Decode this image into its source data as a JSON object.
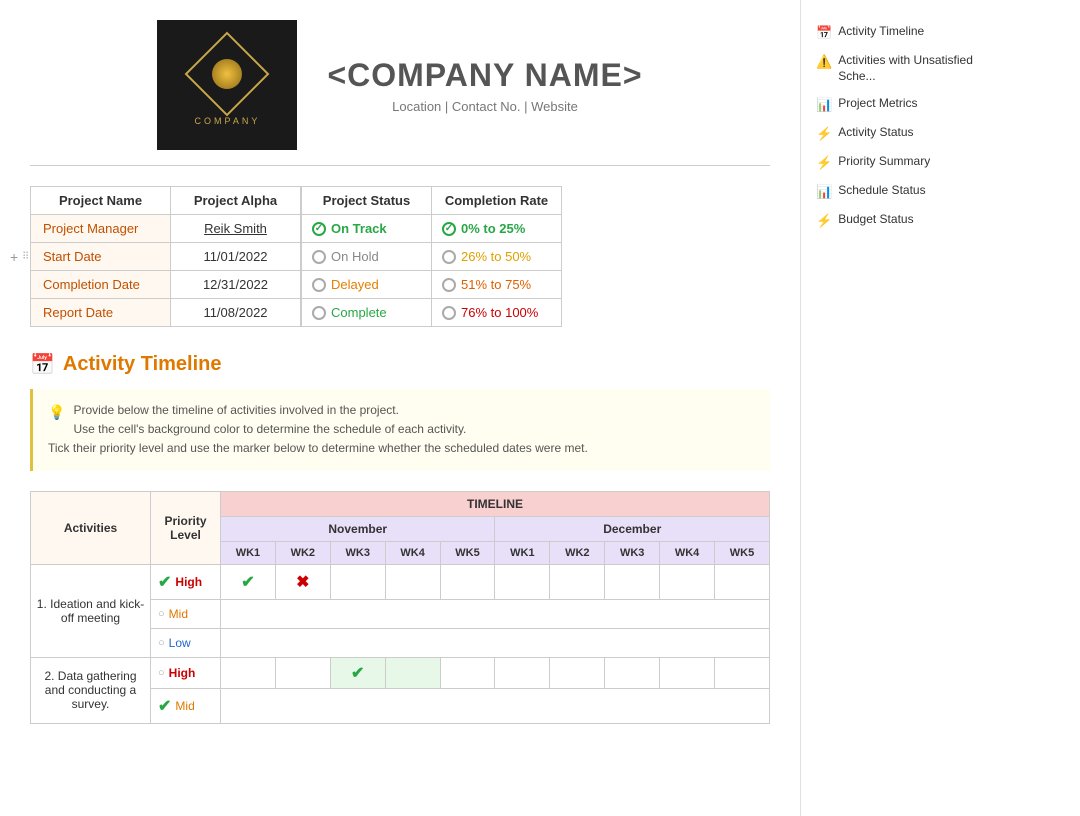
{
  "company": {
    "name": "<COMPANY NAME>",
    "subtitle": "Location | Contact No. | Website",
    "logo_text": "COMPANY"
  },
  "project_table": {
    "col1_header": "Project Name",
    "col2_header": "Project Alpha",
    "rows": [
      {
        "label": "Project Manager",
        "value": "Reik Smith"
      },
      {
        "label": "Start Date",
        "value": "11/01/2022"
      },
      {
        "label": "Completion Date",
        "value": "12/31/2022"
      },
      {
        "label": "Report Date",
        "value": "11/08/2022"
      }
    ]
  },
  "status_section": {
    "col1_header": "Project Status",
    "col2_header": "Completion Rate",
    "statuses": [
      {
        "label": "On Track",
        "checked": true,
        "class": "status-on-track"
      },
      {
        "label": "On Hold",
        "checked": false,
        "class": "status-on-hold"
      },
      {
        "label": "Delayed",
        "checked": false,
        "class": "status-delayed"
      },
      {
        "label": "Complete",
        "checked": false,
        "class": "status-complete"
      }
    ],
    "rates": [
      {
        "label": "0% to 25%",
        "checked": true,
        "class": "rate-0-25"
      },
      {
        "label": "26% to 50%",
        "checked": false,
        "class": "rate-26-50"
      },
      {
        "label": "51% to 75%",
        "checked": false,
        "class": "rate-51-75"
      },
      {
        "label": "76% to 100%",
        "checked": false,
        "class": "rate-76-100"
      }
    ]
  },
  "activity_timeline": {
    "section_icon": "📅",
    "section_title": "Activity Timeline",
    "info_text_1": "Provide below the timeline of activities involved in the project.",
    "info_text_2": "Use the cell's background color to determine the schedule of each activity.",
    "info_text_3": "Tick their priority level and use the marker below to determine whether the scheduled dates were met.",
    "table": {
      "col_activities": "Activities",
      "col_priority": "Priority Level",
      "timeline_header": "TIMELINE",
      "months": [
        "November",
        "December"
      ],
      "weeks": [
        "WK1",
        "WK2",
        "WK3",
        "WK4",
        "WK5",
        "WK1",
        "WK2",
        "WK3",
        "WK4",
        "WK5"
      ],
      "rows": [
        {
          "activity": "1. Ideation and kick-off meeting",
          "priority_high_checked": true,
          "priority_mid_checked": false,
          "priority_low_checked": false,
          "cells": [
            "check",
            "cross",
            "",
            "",
            "",
            "",
            "",
            "",
            "",
            ""
          ]
        },
        {
          "activity": "2. Data gathering and conducting a survey.",
          "priority_high_checked": false,
          "priority_mid_checked": true,
          "priority_low_checked": false,
          "cells": [
            "",
            "",
            "check",
            "green",
            "",
            "",
            "",
            "",
            "",
            ""
          ]
        }
      ]
    }
  },
  "sidebar": {
    "items": [
      {
        "icon": "📅",
        "label": "Activity Timeline",
        "icon_color": "#4a90d9"
      },
      {
        "icon": "⚠️",
        "label": "Activities with Unsatisfied Sche...",
        "icon_color": "#e07800"
      },
      {
        "icon": "📊",
        "label": "Project Metrics",
        "icon_color": "#888"
      },
      {
        "icon": "⚡",
        "label": "Activity Status",
        "icon_color": "#e0a000"
      },
      {
        "icon": "⚡",
        "label": "Priority Summary",
        "icon_color": "#cc0000"
      },
      {
        "icon": "📊",
        "label": "Schedule Status",
        "icon_color": "#4a90d9"
      },
      {
        "icon": "⚡",
        "label": "Budget Status",
        "icon_color": "#e07800"
      }
    ]
  }
}
